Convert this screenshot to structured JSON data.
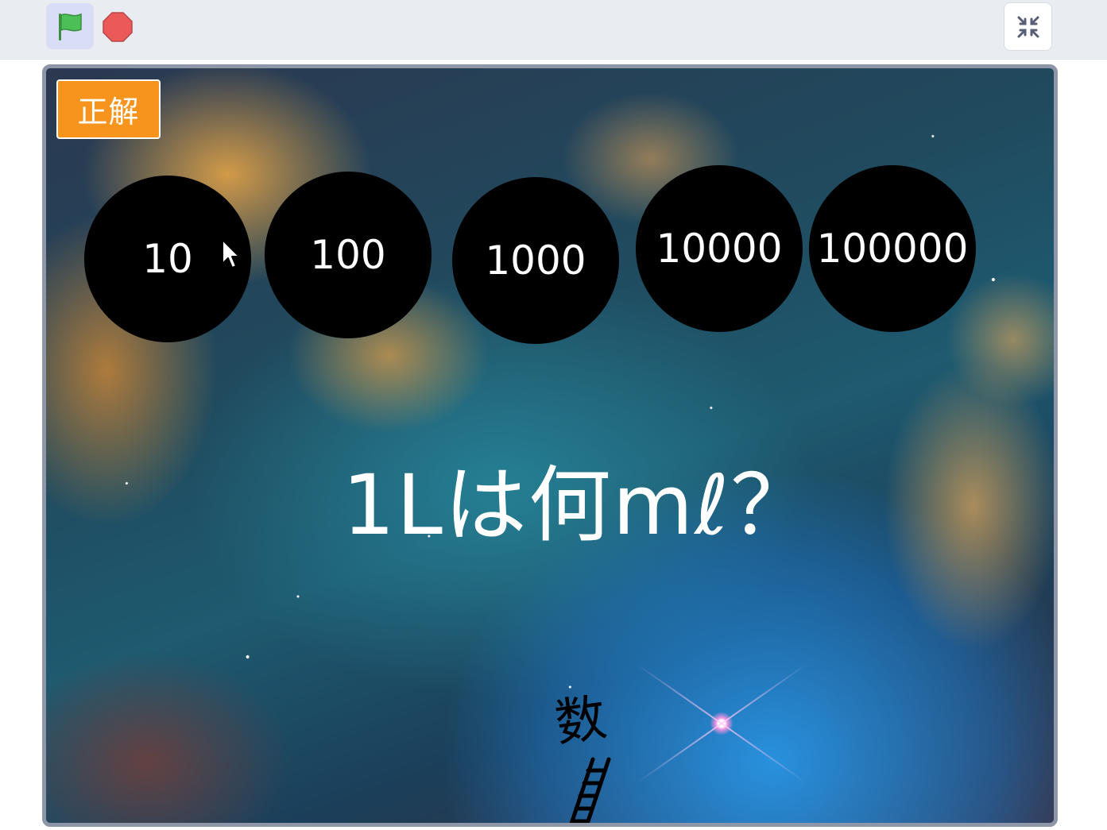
{
  "toolbar": {
    "green_flag_icon": "green-flag-icon",
    "stop_icon": "stop-sign-icon",
    "fullscreen_exit_icon": "shrink-arrows-icon"
  },
  "stage": {
    "correct_label": "正解",
    "question": "1Lは何mℓ？",
    "sprite_char": "数",
    "answers": [
      {
        "label": "10"
      },
      {
        "label": "100"
      },
      {
        "label": "1000"
      },
      {
        "label": "10000"
      },
      {
        "label": "100000"
      }
    ]
  },
  "colors": {
    "toolbar_bg": "#e9edf2",
    "flag_active_bg": "#d9ddf5",
    "flag_green": "#4cbf56",
    "stop_red": "#ec5959",
    "correct_bg": "#f7941d",
    "answer_bg": "#000000",
    "stage_border": "#8e97a8"
  }
}
